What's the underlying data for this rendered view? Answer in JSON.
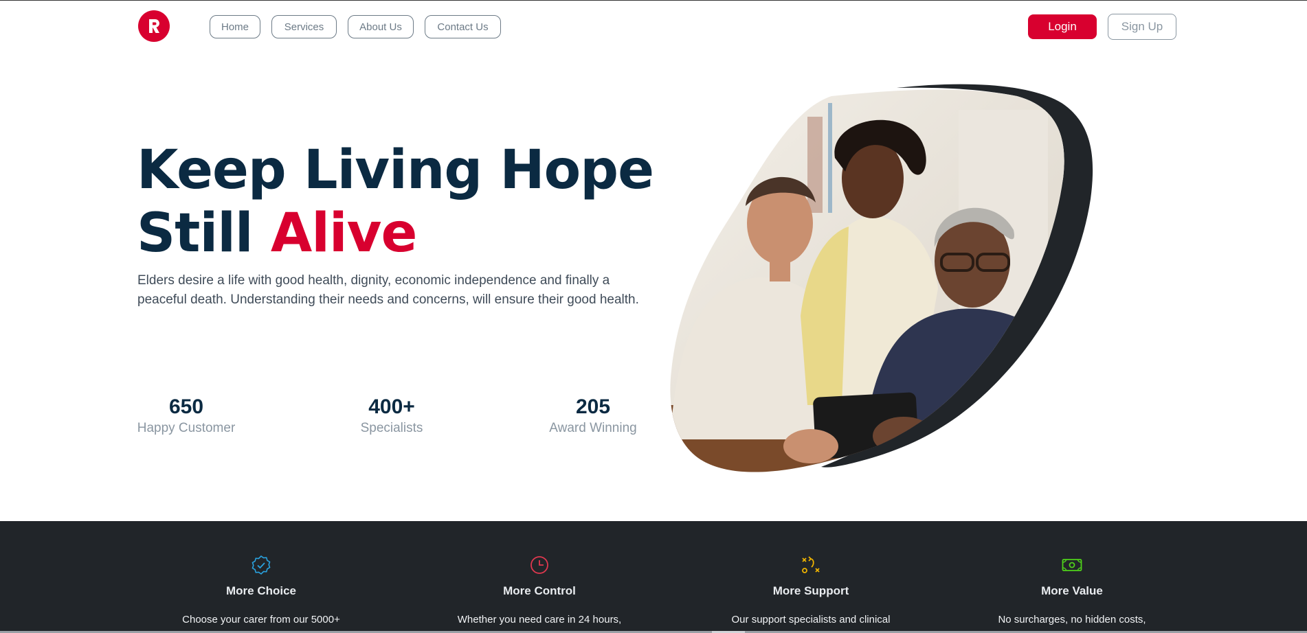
{
  "nav": {
    "links": [
      "Home",
      "Services",
      "About Us",
      "Contact Us"
    ],
    "login_label": "Login",
    "signup_label": "Sign Up"
  },
  "hero": {
    "title_line1": "Keep Living Hope",
    "title_line2_plain": "Still ",
    "title_line2_accent": "Alive",
    "description": "Elders desire a life with good health, dignity, economic independence and finally a peaceful death. Understanding their needs and concerns, will ensure their good health."
  },
  "stats": [
    {
      "value": "650",
      "label": "Happy Customer"
    },
    {
      "value": "400+",
      "label": "Specialists"
    },
    {
      "value": "205",
      "label": "Award Winning"
    }
  ],
  "features": [
    {
      "icon": "badge-check-icon",
      "title": "More Choice",
      "text": "Choose your carer from our 5000+",
      "color": "#2aa3e0"
    },
    {
      "icon": "clock-icon",
      "title": "More Control",
      "text": "Whether you need care in 24 hours,",
      "color": "#e0384f"
    },
    {
      "icon": "strategy-icon",
      "title": "More Support",
      "text": "Our support specialists and clinical",
      "color": "#f0b400"
    },
    {
      "icon": "cash-icon",
      "title": "More Value",
      "text": "No surcharges, no hidden costs,",
      "color": "#4fd11a"
    }
  ],
  "colors": {
    "brand": "#d8002f",
    "heading": "#0b2a42",
    "dark_section": "#212529"
  }
}
